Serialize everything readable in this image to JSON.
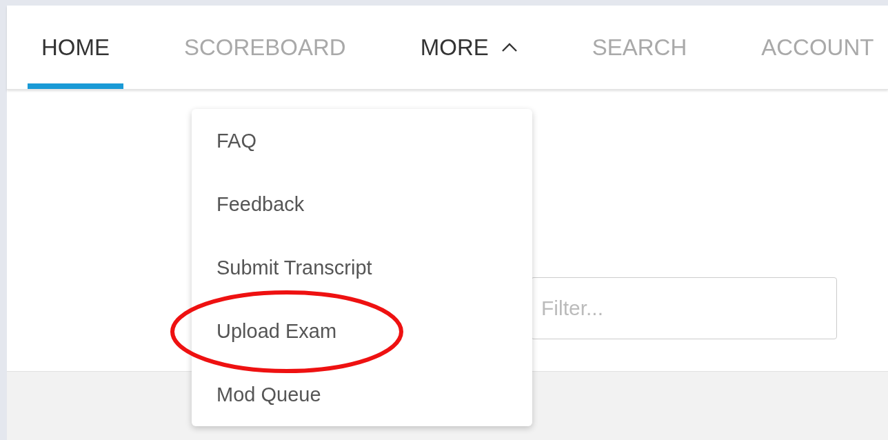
{
  "tabs": [
    {
      "label": "HOME",
      "selected": true,
      "kind": "link"
    },
    {
      "label": "SCOREBOARD",
      "selected": false,
      "kind": "link"
    },
    {
      "label": "MORE",
      "selected": false,
      "kind": "dropdown",
      "expanded": true
    },
    {
      "label": "SEARCH",
      "selected": false,
      "kind": "link"
    },
    {
      "label": "ACCOUNT",
      "selected": false,
      "kind": "link"
    }
  ],
  "more_menu": {
    "items": [
      {
        "label": "FAQ",
        "circled": false
      },
      {
        "label": "Feedback",
        "circled": false
      },
      {
        "label": "Submit Transcript",
        "circled": false
      },
      {
        "label": "Upload Exam",
        "circled": true
      },
      {
        "label": "Mod Queue",
        "circled": false
      }
    ]
  },
  "filter": {
    "placeholder": "Filter..."
  }
}
